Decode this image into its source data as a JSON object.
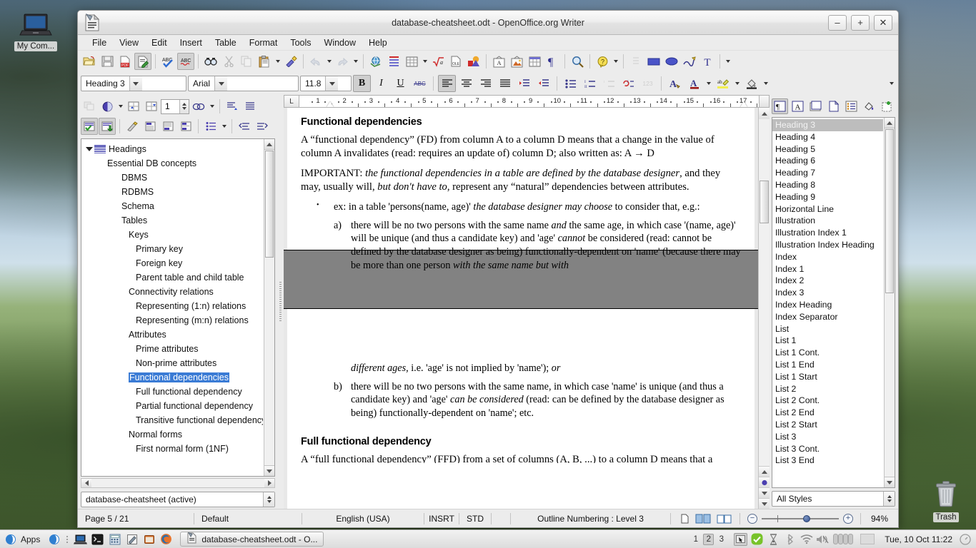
{
  "desktop": {
    "icons": [
      {
        "name": "my-computer",
        "label": "My Com...",
        "icon": "computer-icon"
      },
      {
        "name": "trash",
        "label": "Trash",
        "icon": "trash-icon"
      }
    ]
  },
  "window": {
    "title": "database-cheatsheet.odt - OpenOffice.org Writer",
    "app_icon": "openoffice-writer-icon",
    "controls": {
      "minimize": "–",
      "maximize": "+",
      "close": "✕"
    }
  },
  "menubar": {
    "items": [
      "File",
      "View",
      "Edit",
      "Insert",
      "Table",
      "Format",
      "Tools",
      "Window",
      "Help"
    ]
  },
  "standard_toolbar": {
    "items": [
      {
        "name": "open-icon",
        "state": "normal"
      },
      {
        "name": "save-icon",
        "state": "normal"
      },
      {
        "name": "export-pdf-icon",
        "state": "normal"
      },
      {
        "name": "edit-file-icon",
        "state": "active"
      },
      {
        "name": "spelling-icon",
        "state": "normal"
      },
      {
        "name": "autospellcheck-icon",
        "state": "active"
      },
      {
        "name": "find-replace-icon",
        "state": "normal"
      },
      {
        "name": "cut-icon",
        "state": "disabled"
      },
      {
        "name": "copy-icon",
        "state": "disabled"
      },
      {
        "name": "paste-icon",
        "state": "normal"
      },
      {
        "name": "clone-formatting-icon",
        "state": "normal"
      },
      {
        "name": "undo-icon",
        "state": "disabled"
      },
      {
        "name": "redo-icon",
        "state": "disabled"
      },
      {
        "name": "hyperlink-icon",
        "state": "normal"
      },
      {
        "name": "insert-table-row-icon",
        "state": "normal"
      },
      {
        "name": "insert-table-icon",
        "state": "normal"
      },
      {
        "name": "insert-formula-icon",
        "state": "normal"
      },
      {
        "name": "insert-ole-object-icon",
        "state": "normal"
      },
      {
        "name": "insert-chart-icon",
        "state": "normal"
      },
      {
        "name": "insert-text-frame-icon",
        "state": "normal"
      },
      {
        "name": "insert-image-icon",
        "state": "normal"
      },
      {
        "name": "table-properties-icon",
        "state": "normal"
      },
      {
        "name": "formatting-marks-icon",
        "state": "normal"
      },
      {
        "name": "zoom-icon",
        "state": "normal"
      },
      {
        "name": "help-icon",
        "state": "normal"
      },
      {
        "name": "drawing-rectangle-icon",
        "state": "normal"
      },
      {
        "name": "drawing-ellipse-icon",
        "state": "normal"
      },
      {
        "name": "drawing-freeform-icon",
        "state": "normal"
      },
      {
        "name": "insert-fontwork-icon",
        "state": "normal"
      }
    ]
  },
  "formatting_toolbar": {
    "paragraph_style": "Heading 3",
    "font_name": "Arial",
    "font_size": "11.8",
    "buttons": [
      {
        "name": "bold-button",
        "glyph": "B",
        "state": "active"
      },
      {
        "name": "italic-button",
        "glyph": "I",
        "state": "normal"
      },
      {
        "name": "underline-button",
        "glyph": "U",
        "state": "normal"
      },
      {
        "name": "strikethrough-button",
        "glyph": "ABC",
        "state": "normal"
      },
      {
        "name": "align-left-button",
        "glyph": "",
        "state": "active"
      },
      {
        "name": "align-center-button",
        "glyph": "",
        "state": "normal"
      },
      {
        "name": "align-right-button",
        "glyph": "",
        "state": "normal"
      },
      {
        "name": "justified-button",
        "glyph": "",
        "state": "normal"
      },
      {
        "name": "increase-indent-button",
        "glyph": "",
        "state": "normal"
      },
      {
        "name": "decrease-indent-button",
        "glyph": "",
        "state": "normal"
      },
      {
        "name": "bullet-list-button",
        "glyph": "",
        "state": "normal"
      },
      {
        "name": "numbered-list-button",
        "glyph": "",
        "state": "normal"
      },
      {
        "name": "no-list-button",
        "glyph": "",
        "state": "disabled"
      },
      {
        "name": "restart-numbering-button",
        "glyph": "",
        "state": "normal"
      },
      {
        "name": "numbering-123-button",
        "glyph": "123",
        "state": "disabled"
      },
      {
        "name": "font-color-button",
        "glyph": "A",
        "state": "normal"
      },
      {
        "name": "character-color-button",
        "glyph": "A",
        "state": "normal"
      },
      {
        "name": "highlighting-button",
        "glyph": "ab",
        "state": "normal"
      },
      {
        "name": "background-color-button",
        "glyph": "",
        "state": "normal"
      }
    ]
  },
  "navigator": {
    "toolbar": [
      {
        "name": "toggle-icon",
        "state": "disabled"
      },
      {
        "name": "navigation-icon",
        "state": "normal"
      },
      {
        "name": "promote-chapter-icon",
        "state": "normal"
      },
      {
        "name": "demote-chapter-icon",
        "state": "normal"
      },
      {
        "name": "reminder-icon",
        "state": "normal"
      },
      {
        "name": "header-icon",
        "state": "normal"
      },
      {
        "name": "footer-icon",
        "state": "normal"
      },
      {
        "name": "content-view-icon",
        "state": "active"
      },
      {
        "name": "set-reminder-icon",
        "state": "active"
      },
      {
        "name": "link-icon",
        "state": "normal"
      },
      {
        "name": "drag-mode-icon",
        "state": "normal"
      },
      {
        "name": "promote-level-icon",
        "state": "normal"
      },
      {
        "name": "demote-level-icon",
        "state": "normal"
      },
      {
        "name": "heading-levels-icon",
        "state": "normal"
      },
      {
        "name": "move-up-icon",
        "state": "normal"
      },
      {
        "name": "move-down-icon",
        "state": "normal"
      }
    ],
    "page_number": "1",
    "root_label": "Headings",
    "tree": [
      {
        "label": "Essential DB concepts",
        "level": 1,
        "selected": false
      },
      {
        "label": "DBMS",
        "level": 2,
        "selected": false
      },
      {
        "label": "RDBMS",
        "level": 2,
        "selected": false
      },
      {
        "label": "Schema",
        "level": 2,
        "selected": false
      },
      {
        "label": "Tables",
        "level": 2,
        "selected": false
      },
      {
        "label": "Keys",
        "level": 3,
        "selected": false
      },
      {
        "label": "Primary key",
        "level": 4,
        "selected": false
      },
      {
        "label": "Foreign key",
        "level": 4,
        "selected": false
      },
      {
        "label": "Parent table and child table",
        "level": 4,
        "selected": false
      },
      {
        "label": "Connectivity relations",
        "level": 3,
        "selected": false
      },
      {
        "label": "Representing (1:n) relations",
        "level": 4,
        "selected": false
      },
      {
        "label": "Representing (m:n) relations",
        "level": 4,
        "selected": false
      },
      {
        "label": "Attributes",
        "level": 3,
        "selected": false
      },
      {
        "label": "Prime attributes",
        "level": 4,
        "selected": false
      },
      {
        "label": "Non-prime attributes",
        "level": 4,
        "selected": false
      },
      {
        "label": "Functional dependencies",
        "level": 4,
        "selected": true
      },
      {
        "label": "Full functional dependency",
        "level": 5,
        "selected": false
      },
      {
        "label": "Partial functional dependency",
        "level": 5,
        "selected": false
      },
      {
        "label": "Transitive functional dependency",
        "level": 5,
        "selected": false
      },
      {
        "label": "Normal forms",
        "level": 3,
        "selected": false
      },
      {
        "label": "First normal form (1NF)",
        "level": 4,
        "selected": false
      }
    ],
    "document_selector": "database-cheatsheet (active)"
  },
  "ruler": {
    "unit_marks": [
      "1",
      "2",
      "3",
      "4",
      "5",
      "6",
      "7",
      "8",
      "9",
      "10",
      "11",
      "12",
      "13",
      "14",
      "15",
      "16",
      "17"
    ],
    "tab_corner": "L"
  },
  "document": {
    "page_top": {
      "heading": "Functional dependencies",
      "paragraphs": [
        "A “functional dependency” (FD) from column A to a column D means that a change in the value of column A invalidates (read: requires an update of) column D; also written as: A → D"
      ],
      "important_prefix": "IMPORTANT: ",
      "important_italic_1": "the functional dependencies in a table are defined by the database designer",
      "important_mid": ", and they may, usually will, ",
      "important_italic_2": "but don't have to",
      "important_tail": ", represent any “natural” dependencies between attributes.",
      "bullet_marker": "•",
      "bullet_pre": "ex: in a table 'persons(name, age)' ",
      "bullet_italic": "the database designer may choose",
      "bullet_post": " to consider that, e.g.:",
      "item_a_marker": "a)",
      "item_a_text_1": "there will be no two persons with the same name ",
      "item_a_italic_1": "and",
      "item_a_text_2": " the same age, in which case '(name, age)' will be unique (and thus a candidate key) and 'age' ",
      "item_a_italic_2": "cannot",
      "item_a_text_3": " be considered (read: cannot be defined by the database designer as being) functionally-dependent on 'name' (because there may be more than one person ",
      "item_a_italic_3": "with the same name but with"
    },
    "page_bottom": {
      "cont_italic": "different ages",
      "cont_text": ", i.e. 'age' is not implied by 'name'); ",
      "cont_italic_2": "or",
      "item_b_marker": "b)",
      "item_b_text_1": "there will be no two persons with the same name, in which case 'name' is unique (and thus a candidate key) and 'age' ",
      "item_b_italic_1": "can be considered",
      "item_b_text_2": " (read: can be defined by the database designer as being) functionally-dependent on 'name'; etc.",
      "heading_2": "Full functional dependency",
      "trailing": "A “full functional dependency” (FFD) from a set of columns (A, B, ...) to a column D means that a"
    }
  },
  "styles_pane": {
    "toolbar": [
      {
        "name": "paragraph-styles-icon",
        "state": "active"
      },
      {
        "name": "character-styles-icon",
        "state": "normal"
      },
      {
        "name": "frame-styles-icon",
        "state": "normal"
      },
      {
        "name": "page-styles-icon",
        "state": "normal"
      },
      {
        "name": "list-styles-icon",
        "state": "normal"
      },
      {
        "name": "fill-format-mode-icon",
        "state": "normal"
      },
      {
        "name": "new-style-from-selection-icon",
        "state": "normal"
      }
    ],
    "items": [
      {
        "label": "Heading 3",
        "selected": true
      },
      {
        "label": "Heading 4",
        "selected": false
      },
      {
        "label": "Heading 5",
        "selected": false
      },
      {
        "label": "Heading 6",
        "selected": false
      },
      {
        "label": "Heading 7",
        "selected": false
      },
      {
        "label": "Heading 8",
        "selected": false
      },
      {
        "label": "Heading 9",
        "selected": false
      },
      {
        "label": "Horizontal Line",
        "selected": false
      },
      {
        "label": "Illustration",
        "selected": false
      },
      {
        "label": "Illustration Index 1",
        "selected": false
      },
      {
        "label": "Illustration Index Heading",
        "selected": false
      },
      {
        "label": "Index",
        "selected": false
      },
      {
        "label": "Index 1",
        "selected": false
      },
      {
        "label": "Index 2",
        "selected": false
      },
      {
        "label": "Index 3",
        "selected": false
      },
      {
        "label": "Index Heading",
        "selected": false
      },
      {
        "label": "Index Separator",
        "selected": false
      },
      {
        "label": "List",
        "selected": false
      },
      {
        "label": "List 1",
        "selected": false
      },
      {
        "label": "List 1 Cont.",
        "selected": false
      },
      {
        "label": "List 1 End",
        "selected": false
      },
      {
        "label": "List 1 Start",
        "selected": false
      },
      {
        "label": "List 2",
        "selected": false
      },
      {
        "label": "List 2 Cont.",
        "selected": false
      },
      {
        "label": "List 2 End",
        "selected": false
      },
      {
        "label": "List 2 Start",
        "selected": false
      },
      {
        "label": "List 3",
        "selected": false
      },
      {
        "label": "List 3 Cont.",
        "selected": false
      },
      {
        "label": "List 3 End",
        "selected": false
      }
    ],
    "filter": "All Styles"
  },
  "statusbar": {
    "page": "Page 5 / 21",
    "page_style": "Default",
    "language": "English (USA)",
    "insert_mode": "INSRT",
    "selection_mode": "STD",
    "outline": "Outline Numbering : Level 3",
    "zoom": "94%",
    "view_buttons": [
      "single-page-view-icon",
      "multi-page-view-icon",
      "book-view-icon"
    ],
    "zoom_out": "−",
    "zoom_in": "+"
  },
  "taskbar": {
    "apps_label": "Apps",
    "launchers": [
      "gnome-menu-icon",
      "dots-icon",
      "computer-icon",
      "terminal-icon",
      "calculator-icon",
      "text-editor-icon",
      "archive-manager-icon",
      "firefox-icon"
    ],
    "window_button": "database-cheatsheet.odt - O...",
    "workspaces": [
      "1",
      "2",
      "3"
    ],
    "active_workspace": "2",
    "tray": [
      "window-list-icon",
      "checkmark-icon",
      "update-icon",
      "bluetooth-icon",
      "wifi-icon",
      "volume-mute-icon",
      "columns-icon",
      "blank-icon"
    ],
    "clock": "Tue, 10 Oct 11:22",
    "session_icon": "power-icon"
  },
  "colors": {
    "selection_blue": "#3a7bd5",
    "style_selected_gray": "#bdbdbd",
    "window_chrome": "#ececec",
    "canvas_gray": "#828282"
  }
}
